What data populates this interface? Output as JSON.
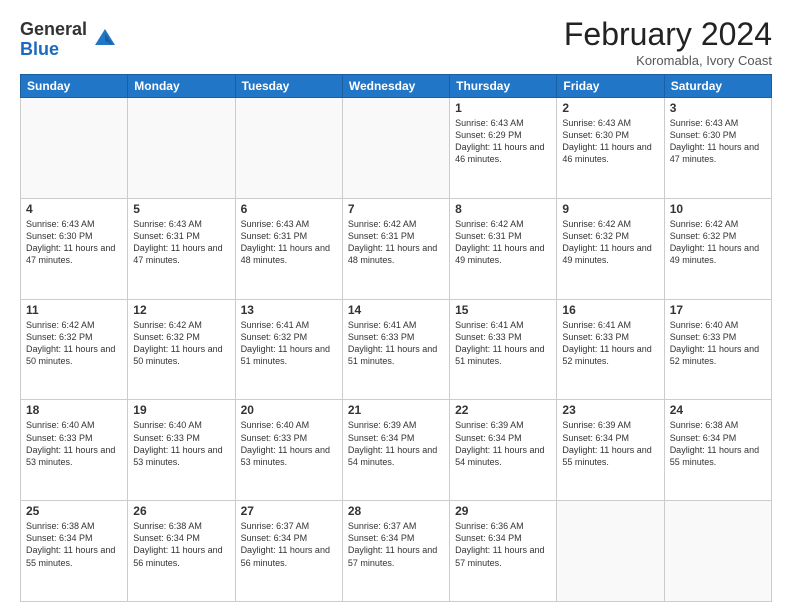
{
  "header": {
    "logo_general": "General",
    "logo_blue": "Blue",
    "title": "February 2024",
    "subtitle": "Koromabla, Ivory Coast"
  },
  "weekdays": [
    "Sunday",
    "Monday",
    "Tuesday",
    "Wednesday",
    "Thursday",
    "Friday",
    "Saturday"
  ],
  "weeks": [
    [
      {
        "day": null,
        "info": null
      },
      {
        "day": null,
        "info": null
      },
      {
        "day": null,
        "info": null
      },
      {
        "day": null,
        "info": null
      },
      {
        "day": "1",
        "info": "Sunrise: 6:43 AM\nSunset: 6:29 PM\nDaylight: 11 hours and 46 minutes."
      },
      {
        "day": "2",
        "info": "Sunrise: 6:43 AM\nSunset: 6:30 PM\nDaylight: 11 hours and 46 minutes."
      },
      {
        "day": "3",
        "info": "Sunrise: 6:43 AM\nSunset: 6:30 PM\nDaylight: 11 hours and 47 minutes."
      }
    ],
    [
      {
        "day": "4",
        "info": "Sunrise: 6:43 AM\nSunset: 6:30 PM\nDaylight: 11 hours and 47 minutes."
      },
      {
        "day": "5",
        "info": "Sunrise: 6:43 AM\nSunset: 6:31 PM\nDaylight: 11 hours and 47 minutes."
      },
      {
        "day": "6",
        "info": "Sunrise: 6:43 AM\nSunset: 6:31 PM\nDaylight: 11 hours and 48 minutes."
      },
      {
        "day": "7",
        "info": "Sunrise: 6:42 AM\nSunset: 6:31 PM\nDaylight: 11 hours and 48 minutes."
      },
      {
        "day": "8",
        "info": "Sunrise: 6:42 AM\nSunset: 6:31 PM\nDaylight: 11 hours and 49 minutes."
      },
      {
        "day": "9",
        "info": "Sunrise: 6:42 AM\nSunset: 6:32 PM\nDaylight: 11 hours and 49 minutes."
      },
      {
        "day": "10",
        "info": "Sunrise: 6:42 AM\nSunset: 6:32 PM\nDaylight: 11 hours and 49 minutes."
      }
    ],
    [
      {
        "day": "11",
        "info": "Sunrise: 6:42 AM\nSunset: 6:32 PM\nDaylight: 11 hours and 50 minutes."
      },
      {
        "day": "12",
        "info": "Sunrise: 6:42 AM\nSunset: 6:32 PM\nDaylight: 11 hours and 50 minutes."
      },
      {
        "day": "13",
        "info": "Sunrise: 6:41 AM\nSunset: 6:32 PM\nDaylight: 11 hours and 51 minutes."
      },
      {
        "day": "14",
        "info": "Sunrise: 6:41 AM\nSunset: 6:33 PM\nDaylight: 11 hours and 51 minutes."
      },
      {
        "day": "15",
        "info": "Sunrise: 6:41 AM\nSunset: 6:33 PM\nDaylight: 11 hours and 51 minutes."
      },
      {
        "day": "16",
        "info": "Sunrise: 6:41 AM\nSunset: 6:33 PM\nDaylight: 11 hours and 52 minutes."
      },
      {
        "day": "17",
        "info": "Sunrise: 6:40 AM\nSunset: 6:33 PM\nDaylight: 11 hours and 52 minutes."
      }
    ],
    [
      {
        "day": "18",
        "info": "Sunrise: 6:40 AM\nSunset: 6:33 PM\nDaylight: 11 hours and 53 minutes."
      },
      {
        "day": "19",
        "info": "Sunrise: 6:40 AM\nSunset: 6:33 PM\nDaylight: 11 hours and 53 minutes."
      },
      {
        "day": "20",
        "info": "Sunrise: 6:40 AM\nSunset: 6:33 PM\nDaylight: 11 hours and 53 minutes."
      },
      {
        "day": "21",
        "info": "Sunrise: 6:39 AM\nSunset: 6:34 PM\nDaylight: 11 hours and 54 minutes."
      },
      {
        "day": "22",
        "info": "Sunrise: 6:39 AM\nSunset: 6:34 PM\nDaylight: 11 hours and 54 minutes."
      },
      {
        "day": "23",
        "info": "Sunrise: 6:39 AM\nSunset: 6:34 PM\nDaylight: 11 hours and 55 minutes."
      },
      {
        "day": "24",
        "info": "Sunrise: 6:38 AM\nSunset: 6:34 PM\nDaylight: 11 hours and 55 minutes."
      }
    ],
    [
      {
        "day": "25",
        "info": "Sunrise: 6:38 AM\nSunset: 6:34 PM\nDaylight: 11 hours and 55 minutes."
      },
      {
        "day": "26",
        "info": "Sunrise: 6:38 AM\nSunset: 6:34 PM\nDaylight: 11 hours and 56 minutes."
      },
      {
        "day": "27",
        "info": "Sunrise: 6:37 AM\nSunset: 6:34 PM\nDaylight: 11 hours and 56 minutes."
      },
      {
        "day": "28",
        "info": "Sunrise: 6:37 AM\nSunset: 6:34 PM\nDaylight: 11 hours and 57 minutes."
      },
      {
        "day": "29",
        "info": "Sunrise: 6:36 AM\nSunset: 6:34 PM\nDaylight: 11 hours and 57 minutes."
      },
      {
        "day": null,
        "info": null
      },
      {
        "day": null,
        "info": null
      }
    ]
  ]
}
